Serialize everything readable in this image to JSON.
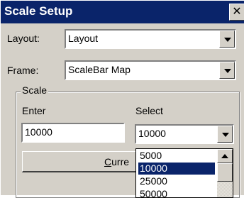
{
  "window": {
    "title": "Scale Setup",
    "close_glyph": "✕",
    "colors": {
      "titlebar": "#0a246a",
      "face": "#d4d0c8",
      "selection": "#0a246a"
    }
  },
  "layout_row": {
    "label": "Layout:",
    "value": "Layout"
  },
  "frame_row": {
    "label": "Frame:",
    "value": "ScaleBar Map"
  },
  "scale_group": {
    "title": "Scale",
    "enter_label": "Enter",
    "enter_value": "10000",
    "select_label": "Select",
    "select_value": "10000",
    "current_button_label": "Curre"
  },
  "dropdown_list": {
    "items": [
      "5000",
      "10000",
      "25000",
      "50000"
    ],
    "selected_index": 1
  }
}
